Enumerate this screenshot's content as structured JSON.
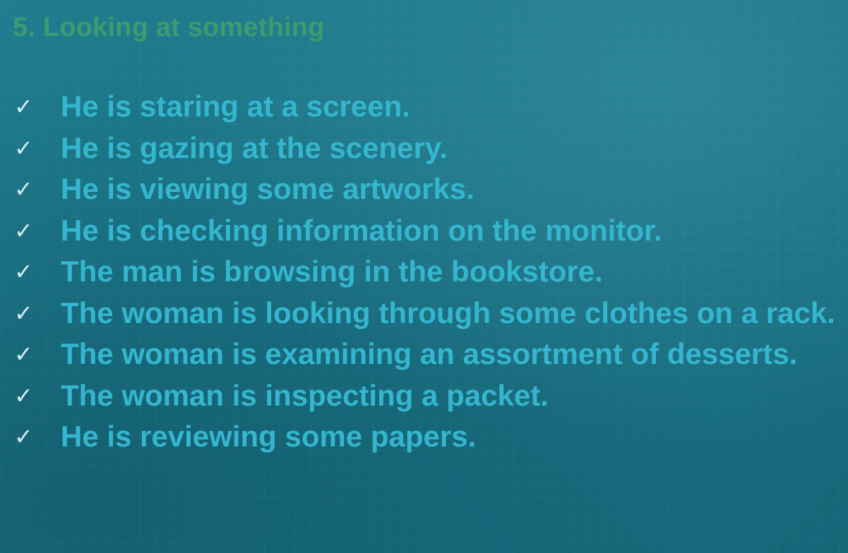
{
  "slide": {
    "title": "5. Looking at something",
    "check_glyph": "✓",
    "items": [
      "He is staring at a screen.",
      "He is gazing at the scenery.",
      "He is viewing some artworks.",
      "He is checking information on the monitor.",
      "The man is browsing in the bookstore.",
      "The woman is looking through some clothes on a rack.",
      "The woman is examining an assortment of desserts.",
      "The woman is inspecting a packet.",
      "He is reviewing some papers."
    ]
  },
  "colors": {
    "background": "#1a7385",
    "title": "#3f9a72",
    "item_text": "#35b6cf",
    "check": "#d6eef2"
  }
}
